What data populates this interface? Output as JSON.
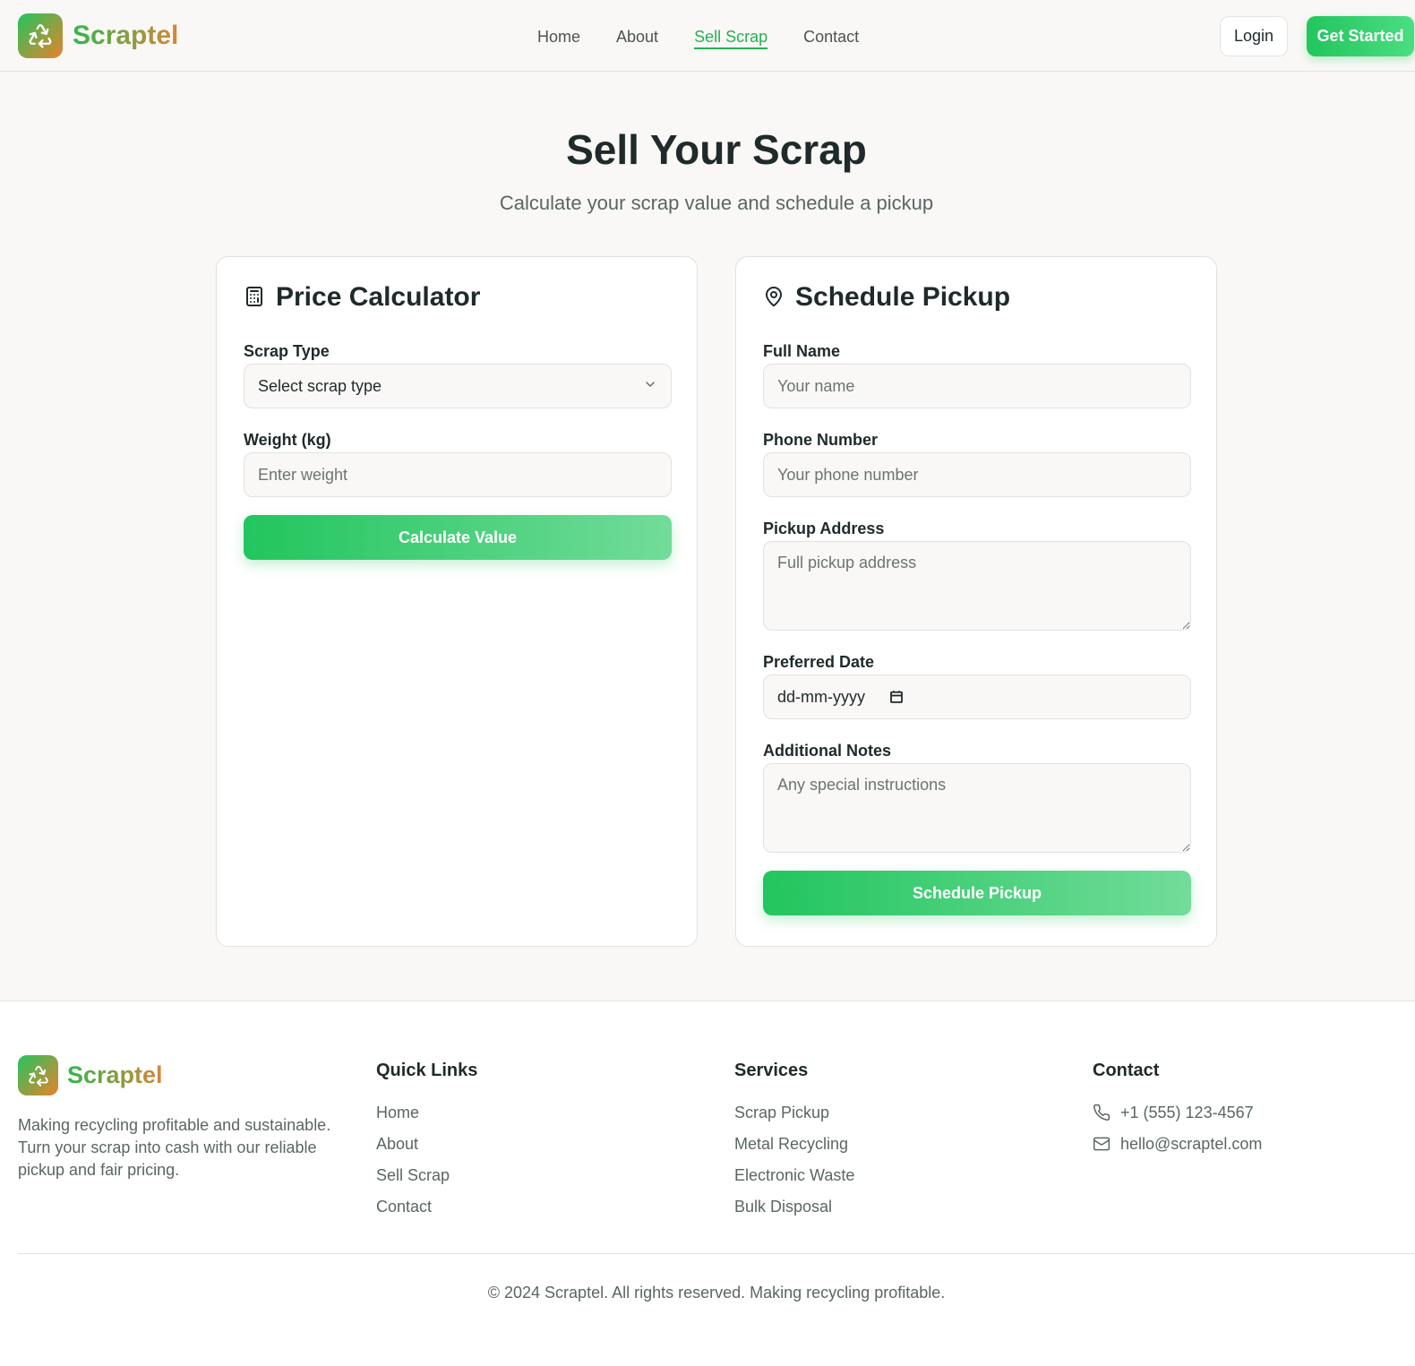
{
  "brand": {
    "name": "Scraptel",
    "logo_icon": "recycle-icon"
  },
  "nav": {
    "items": [
      {
        "label": "Home",
        "active": false
      },
      {
        "label": "About",
        "active": false
      },
      {
        "label": "Sell Scrap",
        "active": true
      },
      {
        "label": "Contact",
        "active": false
      }
    ],
    "login_label": "Login",
    "get_started_label": "Get Started"
  },
  "hero": {
    "title": "Sell Your Scrap",
    "subtitle": "Calculate your scrap value and schedule a pickup"
  },
  "calculator": {
    "title": "Price Calculator",
    "icon": "calculator-icon",
    "scrap_type_label": "Scrap Type",
    "scrap_type_value": "Select scrap type",
    "weight_label": "Weight (kg)",
    "weight_placeholder": "Enter weight",
    "button_label": "Calculate Value"
  },
  "pickup": {
    "title": "Schedule Pickup",
    "icon": "map-pin-icon",
    "name_label": "Full Name",
    "name_placeholder": "Your name",
    "phone_label": "Phone Number",
    "phone_placeholder": "Your phone number",
    "address_label": "Pickup Address",
    "address_placeholder": "Full pickup address",
    "date_label": "Preferred Date",
    "date_value": "dd-mm-yyyy",
    "notes_label": "Additional Notes",
    "notes_placeholder": "Any special instructions",
    "button_label": "Schedule Pickup"
  },
  "footer": {
    "description": "Making recycling profitable and sustainable. Turn your scrap into cash with our reliable pickup and fair pricing.",
    "quick_links": {
      "title": "Quick Links",
      "items": [
        "Home",
        "About",
        "Sell Scrap",
        "Contact"
      ]
    },
    "services": {
      "title": "Services",
      "items": [
        "Scrap Pickup",
        "Metal Recycling",
        "Electronic Waste",
        "Bulk Disposal"
      ]
    },
    "contact": {
      "title": "Contact",
      "phone": "+1 (555) 123-4567",
      "email": "hello@scraptel.com"
    },
    "copyright": "© 2024 Scraptel. All rights reserved. Making recycling profitable."
  },
  "colors": {
    "accent": "#22c55e",
    "brand_orange": "#e9812b",
    "background": "#faf8f6"
  }
}
